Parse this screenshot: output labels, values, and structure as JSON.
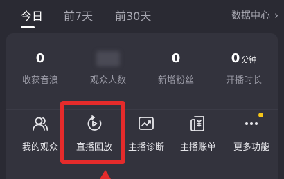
{
  "tabs": [
    {
      "label": "今日",
      "active": true
    },
    {
      "label": "前7天",
      "active": false
    },
    {
      "label": "前30天",
      "active": false
    }
  ],
  "data_center": {
    "label": "数据中心",
    "icon": "chevron-right-icon"
  },
  "stats": [
    {
      "value": "0",
      "unit": "",
      "label": "收获音浪"
    },
    {
      "value": "",
      "unit": "",
      "label": "观众人数",
      "obscured": true
    },
    {
      "value": "0",
      "unit": "",
      "label": "新增粉丝"
    },
    {
      "value": "0",
      "unit": "分钟",
      "label": "开播时长"
    }
  ],
  "tools": [
    {
      "label": "我的观众",
      "icon": "audience-icon"
    },
    {
      "label": "直播回放",
      "icon": "replay-icon"
    },
    {
      "label": "主播诊断",
      "icon": "diagnosis-icon"
    },
    {
      "label": "主播账单",
      "icon": "bill-icon"
    },
    {
      "label": "更多功能",
      "icon": "more-icon",
      "badge": true
    }
  ],
  "colors": {
    "background": "#2a2a33",
    "panel": "#33333d",
    "highlight": "#e52b2b",
    "badge": "#f5c518",
    "muted_text": "#9b9ba6"
  }
}
